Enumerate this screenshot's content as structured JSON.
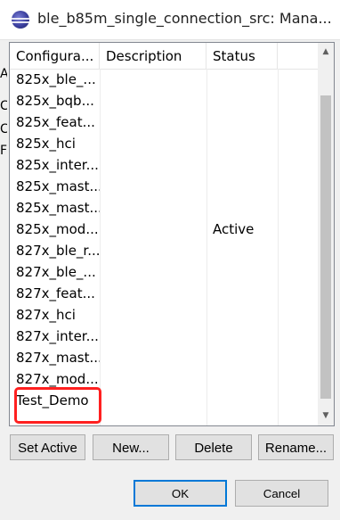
{
  "window": {
    "title": "ble_b85m_single_connection_src: Mana..."
  },
  "background_fragments": [
    "A",
    "C",
    "C",
    "F"
  ],
  "table": {
    "headers": [
      "Configura...",
      "Description",
      "Status"
    ],
    "rows": [
      {
        "name": "825x_ble_...",
        "description": "",
        "status": ""
      },
      {
        "name": "825x_bqb...",
        "description": "",
        "status": ""
      },
      {
        "name": "825x_feat...",
        "description": "",
        "status": ""
      },
      {
        "name": "825x_hci",
        "description": "",
        "status": ""
      },
      {
        "name": "825x_inter...",
        "description": "",
        "status": ""
      },
      {
        "name": "825x_mast...",
        "description": "",
        "status": ""
      },
      {
        "name": "825x_mast...",
        "description": "",
        "status": ""
      },
      {
        "name": "825x_mod...",
        "description": "",
        "status": "Active"
      },
      {
        "name": "827x_ble_r...",
        "description": "",
        "status": ""
      },
      {
        "name": "827x_ble_...",
        "description": "",
        "status": ""
      },
      {
        "name": "827x_feat...",
        "description": "",
        "status": ""
      },
      {
        "name": "827x_hci",
        "description": "",
        "status": ""
      },
      {
        "name": "827x_inter...",
        "description": "",
        "status": ""
      },
      {
        "name": "827x_mast...",
        "description": "",
        "status": ""
      },
      {
        "name": "827x_mod...",
        "description": "",
        "status": ""
      },
      {
        "name": "Test_Demo",
        "description": "",
        "status": ""
      },
      {
        "name": "",
        "description": "",
        "status": ""
      }
    ],
    "highlighted_row": "Test_Demo"
  },
  "buttons": {
    "set_active": "Set Active",
    "new": "New...",
    "delete": "Delete",
    "rename": "Rename...",
    "ok": "OK",
    "cancel": "Cancel"
  },
  "colors": {
    "highlight": "#ff2020",
    "default_button_border": "#0078d7"
  }
}
